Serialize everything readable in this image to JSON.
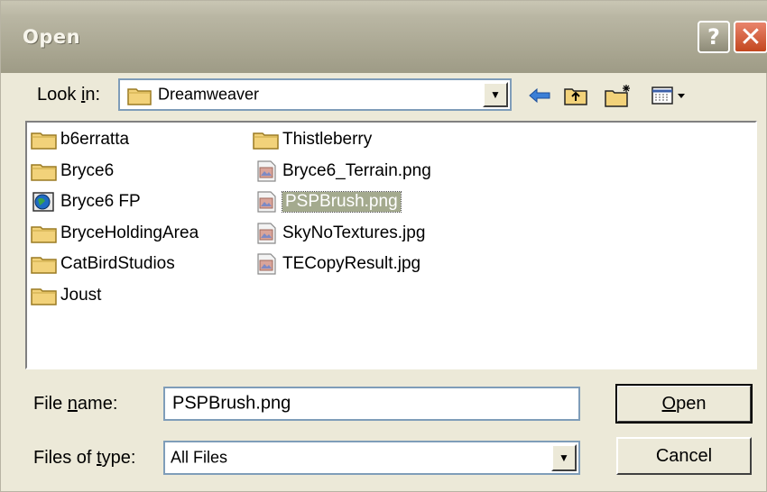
{
  "window": {
    "title": "Open"
  },
  "titlebar": {
    "help": "?",
    "close": "✕"
  },
  "toolbar": {
    "look_in_prefix": "Look ",
    "look_in_mnemonic": "i",
    "look_in_suffix": "n:",
    "location": "Dreamweaver",
    "icons": [
      "back-arrow-icon",
      "up-folder-icon",
      "new-folder-icon",
      "view-menu-icon"
    ]
  },
  "files": {
    "column1": [
      {
        "name": "b6erratta",
        "icon": "folder-icon"
      },
      {
        "name": "Bryce6",
        "icon": "folder-icon"
      },
      {
        "name": "Bryce6 FP",
        "icon": "globe-icon"
      },
      {
        "name": "BryceHoldingArea",
        "icon": "folder-icon"
      },
      {
        "name": "CatBirdStudios",
        "icon": "folder-icon"
      },
      {
        "name": "Joust",
        "icon": "folder-icon"
      }
    ],
    "column2": [
      {
        "name": "Thistleberry",
        "icon": "folder-icon"
      },
      {
        "name": "Bryce6_Terrain.png",
        "icon": "image-file-icon"
      },
      {
        "name": "PSPBrush.png",
        "icon": "image-file-icon",
        "selected": true
      },
      {
        "name": "SkyNoTextures.jpg",
        "icon": "image-file-icon"
      },
      {
        "name": "TECopyResult.jpg",
        "icon": "image-file-icon"
      }
    ]
  },
  "filename": {
    "label_prefix": "File ",
    "label_mnemonic": "n",
    "label_suffix": "ame:",
    "value": "PSPBrush.png"
  },
  "filetype": {
    "label_prefix": "Files of ",
    "label_mnemonic": "t",
    "label_suffix": "ype:",
    "value": "All Files"
  },
  "buttons": {
    "open_mnemonic": "O",
    "open_rest": "pen",
    "cancel": "Cancel"
  }
}
